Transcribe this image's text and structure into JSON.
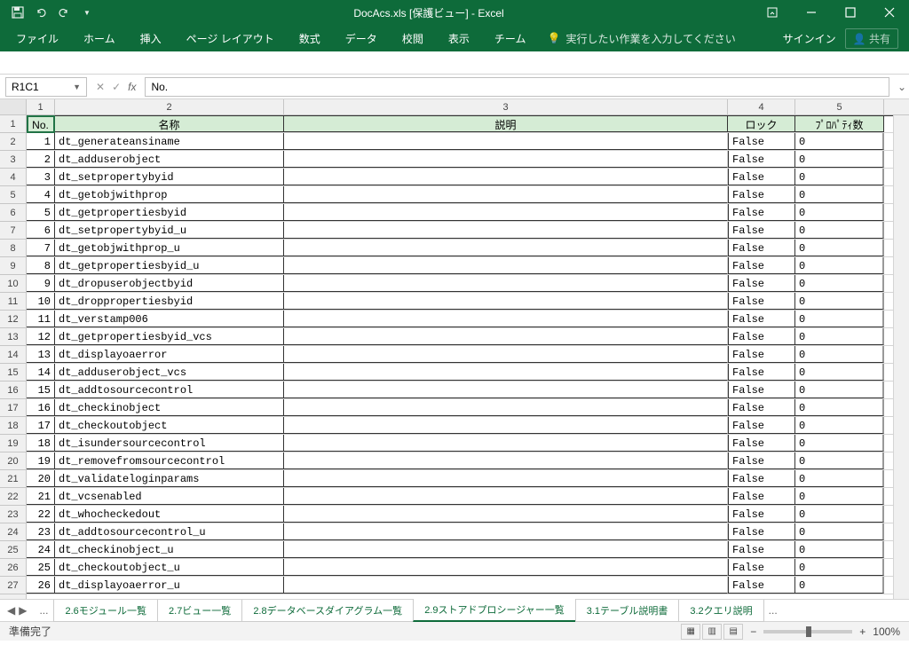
{
  "title": "DocAcs.xls  [保護ビュー] - Excel",
  "qat": {
    "save": "保存",
    "undo": "元に戻す",
    "redo": "やり直し",
    "customize": "▾"
  },
  "ribbon": {
    "file": "ファイル",
    "home": "ホーム",
    "insert": "挿入",
    "pagelayout": "ページ レイアウト",
    "formulas": "数式",
    "data": "データ",
    "review": "校閲",
    "view": "表示",
    "team": "チーム",
    "tellme": "実行したい作業を入力してください",
    "signin": "サインイン",
    "share": "共有"
  },
  "namebox": "R1C1",
  "formula": "No.",
  "col_headers": [
    "1",
    "2",
    "3",
    "4",
    "5"
  ],
  "table_headers": {
    "no": "No.",
    "name": "名称",
    "desc": "説明",
    "lock": "ロック",
    "props": "ﾌﾟﾛﾊﾟﾃｨ数"
  },
  "rows": [
    {
      "n": "1",
      "name": "dt_generateansiname",
      "lock": "False",
      "p": "0"
    },
    {
      "n": "2",
      "name": "dt_adduserobject",
      "lock": "False",
      "p": "0"
    },
    {
      "n": "3",
      "name": "dt_setpropertybyid",
      "lock": "False",
      "p": "0"
    },
    {
      "n": "4",
      "name": "dt_getobjwithprop",
      "lock": "False",
      "p": "0"
    },
    {
      "n": "5",
      "name": "dt_getpropertiesbyid",
      "lock": "False",
      "p": "0"
    },
    {
      "n": "6",
      "name": "dt_setpropertybyid_u",
      "lock": "False",
      "p": "0"
    },
    {
      "n": "7",
      "name": "dt_getobjwithprop_u",
      "lock": "False",
      "p": "0"
    },
    {
      "n": "8",
      "name": "dt_getpropertiesbyid_u",
      "lock": "False",
      "p": "0"
    },
    {
      "n": "9",
      "name": "dt_dropuserobjectbyid",
      "lock": "False",
      "p": "0"
    },
    {
      "n": "10",
      "name": "dt_droppropertiesbyid",
      "lock": "False",
      "p": "0"
    },
    {
      "n": "11",
      "name": "dt_verstamp006",
      "lock": "False",
      "p": "0"
    },
    {
      "n": "12",
      "name": "dt_getpropertiesbyid_vcs",
      "lock": "False",
      "p": "0"
    },
    {
      "n": "13",
      "name": "dt_displayoaerror",
      "lock": "False",
      "p": "0"
    },
    {
      "n": "14",
      "name": "dt_adduserobject_vcs",
      "lock": "False",
      "p": "0"
    },
    {
      "n": "15",
      "name": "dt_addtosourcecontrol",
      "lock": "False",
      "p": "0"
    },
    {
      "n": "16",
      "name": "dt_checkinobject",
      "lock": "False",
      "p": "0"
    },
    {
      "n": "17",
      "name": "dt_checkoutobject",
      "lock": "False",
      "p": "0"
    },
    {
      "n": "18",
      "name": "dt_isundersourcecontrol",
      "lock": "False",
      "p": "0"
    },
    {
      "n": "19",
      "name": "dt_removefromsourcecontrol",
      "lock": "False",
      "p": "0"
    },
    {
      "n": "20",
      "name": "dt_validateloginparams",
      "lock": "False",
      "p": "0"
    },
    {
      "n": "21",
      "name": "dt_vcsenabled",
      "lock": "False",
      "p": "0"
    },
    {
      "n": "22",
      "name": "dt_whocheckedout",
      "lock": "False",
      "p": "0"
    },
    {
      "n": "23",
      "name": "dt_addtosourcecontrol_u",
      "lock": "False",
      "p": "0"
    },
    {
      "n": "24",
      "name": "dt_checkinobject_u",
      "lock": "False",
      "p": "0"
    },
    {
      "n": "25",
      "name": "dt_checkoutobject_u",
      "lock": "False",
      "p": "0"
    },
    {
      "n": "26",
      "name": "dt_displayoaerror_u",
      "lock": "False",
      "p": "0"
    }
  ],
  "sheet_tabs": {
    "ellipsis": "...",
    "t1": "2.6モジュール一覧",
    "t2": "2.7ビュー一覧",
    "t3": "2.8データベースダイアグラム一覧",
    "t4": "2.9ストアドプロシージャー一覧",
    "t5": "3.1テーブル説明書",
    "t6": "3.2クエリ説明",
    "more": "..."
  },
  "status": {
    "ready": "準備完了",
    "zoom": "100%"
  }
}
